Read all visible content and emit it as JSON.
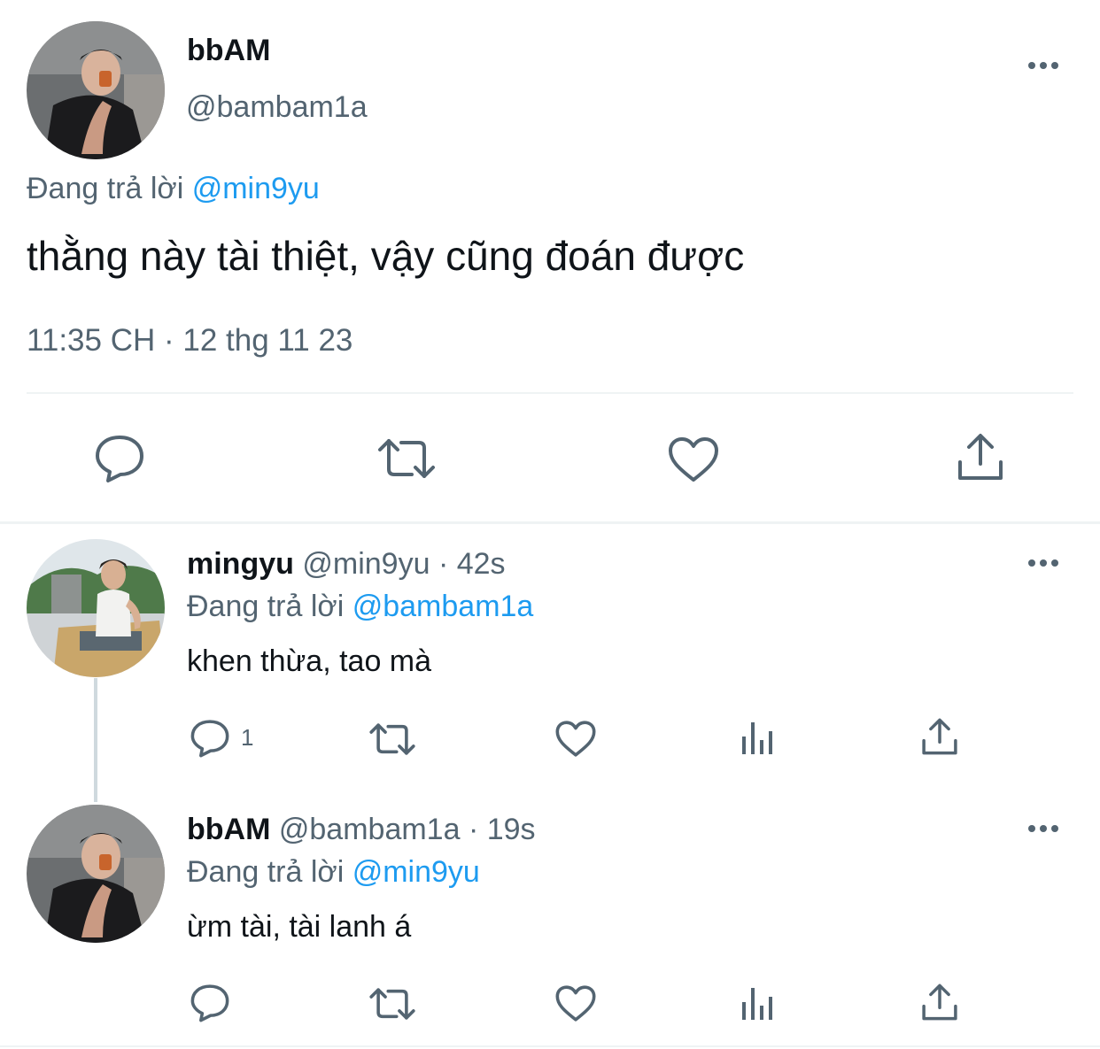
{
  "main_tweet": {
    "display_name": "bbAM",
    "handle": "@bambam1a",
    "reply_prefix": "Đang trả lời",
    "reply_to": "@min9yu",
    "text": "thằng này tài thiệt, vậy cũng đoán được",
    "timestamp": "11:35 CH · 12 thg 11 23"
  },
  "replies": [
    {
      "display_name": "mingyu",
      "handle": "@min9yu",
      "time": "· 42s",
      "reply_prefix": "Đang trả lời",
      "reply_to": "@bambam1a",
      "text": "khen thừa, tao mà",
      "reply_count": "1"
    },
    {
      "display_name": "bbAM",
      "handle": "@bambam1a",
      "time": "· 19s",
      "reply_prefix": "Đang trả lời",
      "reply_to": "@min9yu",
      "text": "ừm tài, tài lanh á",
      "reply_count": ""
    }
  ],
  "icons": [
    "reply-icon",
    "retweet-icon",
    "like-icon",
    "analytics-icon",
    "share-icon",
    "more-icon"
  ],
  "colors": {
    "link": "#1d9bf0",
    "muted": "#536471",
    "text": "#0f1419"
  }
}
